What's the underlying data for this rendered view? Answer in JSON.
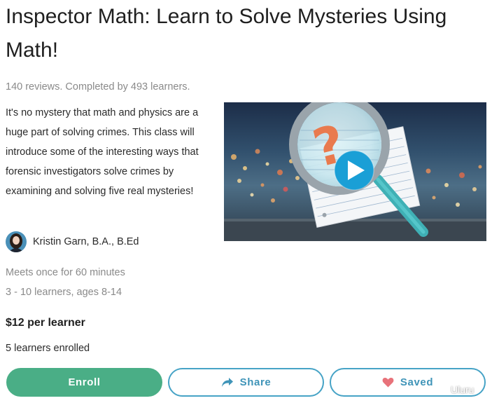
{
  "course": {
    "title": "Inspector Math: Learn to Solve Mysteries Using Math!",
    "reviews_summary": "140 reviews. Completed by 493 learners.",
    "description": "It's no mystery that math and physics are a huge part of solving crimes. This class will introduce some of the interesting ways that forensic investigators solve crimes by examining and solving five real mysteries!",
    "teacher_name": "Kristin Garn, B.A., B.Ed",
    "schedule": "Meets once for 60 minutes",
    "class_size": "3 - 10 learners, ages 8-14",
    "price": "$12 per learner",
    "enrolled": "5 learners enrolled"
  },
  "actions": {
    "enroll_label": "Enroll",
    "share_label": "Share",
    "saved_label": "Saved"
  },
  "video": {
    "icons": [
      "magnifying-glass-icon",
      "question-mark-icon",
      "play-icon"
    ]
  },
  "watermark": {
    "text": "Uluru"
  },
  "colors": {
    "enroll_bg": "#4aae86",
    "outline_accent": "#46a3c6",
    "heart": "#e8727a",
    "play": "#1a9fd6"
  }
}
